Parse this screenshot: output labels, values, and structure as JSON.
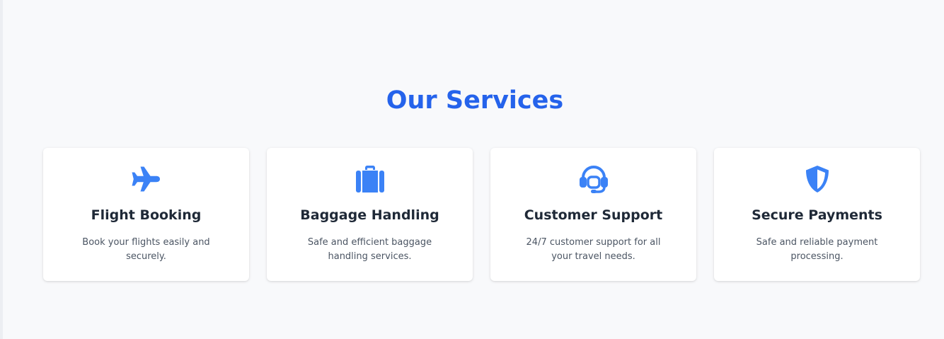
{
  "section": {
    "title": "Our Services"
  },
  "colors": {
    "accent": "#2563eb",
    "icon": "#3b82f6",
    "background": "#f8f9fb",
    "card": "#ffffff"
  },
  "services": [
    {
      "icon": "airplane-icon",
      "title": "Flight Booking",
      "description": "Book your flights easily and securely."
    },
    {
      "icon": "suitcase-icon",
      "title": "Baggage Handling",
      "description": "Safe and efficient baggage handling services."
    },
    {
      "icon": "headset-icon",
      "title": "Customer Support",
      "description": "24/7 customer support for all your travel needs."
    },
    {
      "icon": "shield-icon",
      "title": "Secure Payments",
      "description": "Safe and reliable payment processing."
    }
  ]
}
